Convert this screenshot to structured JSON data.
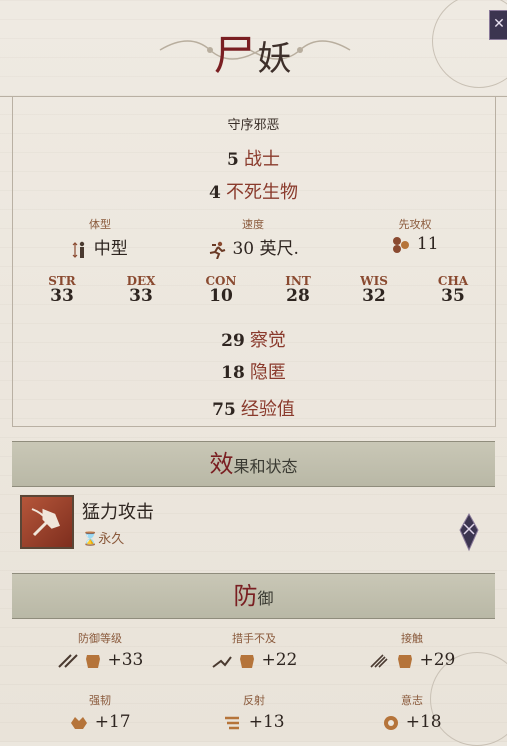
{
  "header": {
    "title_first": "尸",
    "title_rest": "妖",
    "close_label": "✕"
  },
  "alignment": "守序邪恶",
  "classes": [
    {
      "level": "5",
      "name": "战士"
    },
    {
      "level": "4",
      "name": "不死生物"
    }
  ],
  "size": {
    "label": "体型",
    "value": "中型"
  },
  "speed": {
    "label": "速度",
    "value": "30 英尺."
  },
  "initiative": {
    "label": "先攻权",
    "value": "11"
  },
  "abilities": [
    {
      "key": "STR",
      "value": "33"
    },
    {
      "key": "DEX",
      "value": "33"
    },
    {
      "key": "CON",
      "value": "10"
    },
    {
      "key": "INT",
      "value": "28"
    },
    {
      "key": "WIS",
      "value": "32"
    },
    {
      "key": "CHA",
      "value": "35"
    }
  ],
  "skills": [
    {
      "value": "29",
      "name": "察觉"
    },
    {
      "value": "18",
      "name": "隐匿"
    },
    {
      "value": "75",
      "name": "经验值"
    }
  ],
  "effects_section": {
    "title_first": "效",
    "title_rest": "果和状态"
  },
  "effect": {
    "name": "猛力攻击",
    "duration": "永久"
  },
  "defense_section": {
    "title_first": "防",
    "title_rest": "御"
  },
  "defense": [
    {
      "label": "防御等级",
      "value": "+33"
    },
    {
      "label": "措手不及",
      "value": "+22"
    },
    {
      "label": "接触",
      "value": "+29"
    },
    {
      "label": "强韧",
      "value": "+17"
    },
    {
      "label": "反射",
      "value": "+13"
    },
    {
      "label": "意志",
      "value": "+18"
    }
  ],
  "colors": {
    "accent_red": "#7a1f22",
    "label_brown": "#8a5a3c",
    "banner": "#bfbdab"
  }
}
